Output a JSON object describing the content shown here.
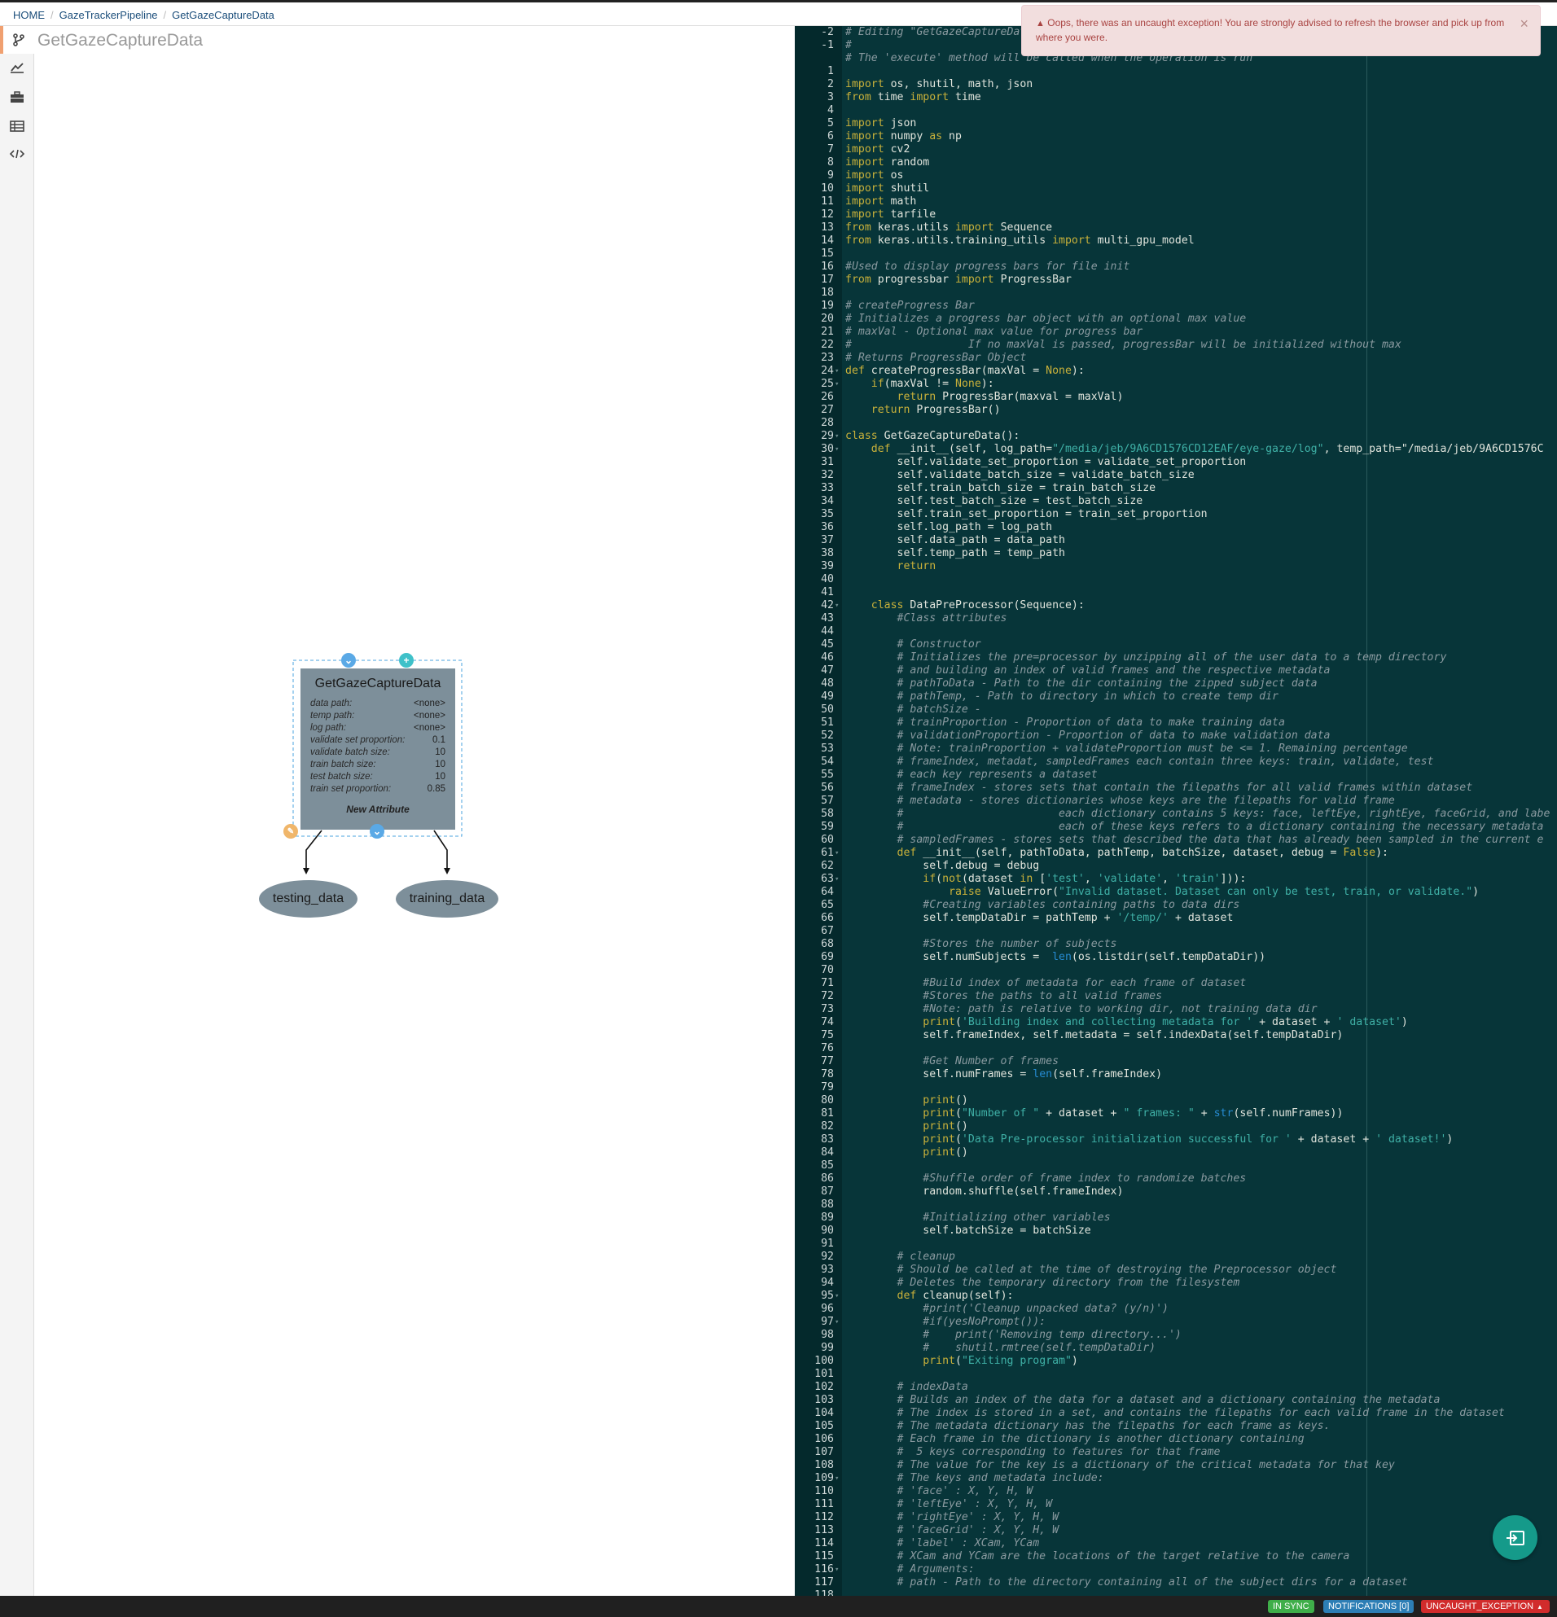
{
  "breadcrumb": {
    "home": "HOME",
    "project": "GazeTrackerPipeline",
    "current": "GetGazeCaptureData"
  },
  "canvas": {
    "title": "GetGazeCaptureData"
  },
  "node": {
    "title": "GetGazeCaptureData",
    "attributes": [
      {
        "key": "data path:",
        "value": "<none>"
      },
      {
        "key": "temp path:",
        "value": "<none>"
      },
      {
        "key": "log path:",
        "value": "<none>"
      },
      {
        "key": "validate set proportion:",
        "value": "0.1"
      },
      {
        "key": "validate batch size:",
        "value": "10"
      },
      {
        "key": "train batch size:",
        "value": "10"
      },
      {
        "key": "test batch size:",
        "value": "10"
      },
      {
        "key": "train set proportion:",
        "value": "0.85"
      }
    ],
    "new_attribute": "New Attribute"
  },
  "outputs": {
    "left": "testing_data",
    "right": "training_data"
  },
  "alert": {
    "message": "Oops, there was an uncaught exception! You are strongly advised to refresh the browser and pick up from where you were.",
    "close": "×"
  },
  "status": {
    "sync": "IN SYNC",
    "notifications": "NOTIFICATIONS [0]",
    "exception": "UNCAUGHT_EXCEPTION"
  },
  "colors": {
    "editor_bg": "#073539",
    "node_bg": "#7d8f9a",
    "alert_bg": "#f2dede",
    "fab": "#159a8a",
    "sync_badge": "#3fae49",
    "notif_badge": "#2d7eb5",
    "exception_badge": "#d12c2c"
  },
  "icons": {
    "leftbar": [
      "branch-icon",
      "chart-icon",
      "toolbox-icon",
      "table-icon",
      "code-icon"
    ],
    "fab": "exit-panel-icon"
  },
  "editor_lines": [
    {
      "n": "-2",
      "t": "# Editing \"GetGazeCaptureData\" Implementation",
      "c": "c"
    },
    {
      "n": "-1",
      "t": "#",
      "c": "c"
    },
    {
      "n": "",
      "t": "# The 'execute' method will be called when the operation is run",
      "c": "c"
    },
    {
      "n": "1",
      "t": "",
      "c": ""
    },
    {
      "n": "2",
      "t": "import os, shutil, math, json",
      "c": "imp"
    },
    {
      "n": "3",
      "t": "from time import time",
      "c": "imp"
    },
    {
      "n": "4",
      "t": "",
      "c": ""
    },
    {
      "n": "5",
      "t": "import json",
      "c": "imp"
    },
    {
      "n": "6",
      "t": "import numpy as np",
      "c": "imp"
    },
    {
      "n": "7",
      "t": "import cv2",
      "c": "imp"
    },
    {
      "n": "8",
      "t": "import random",
      "c": "imp"
    },
    {
      "n": "9",
      "t": "import os",
      "c": "imp"
    },
    {
      "n": "10",
      "t": "import shutil",
      "c": "imp"
    },
    {
      "n": "11",
      "t": "import math",
      "c": "imp"
    },
    {
      "n": "12",
      "t": "import tarfile",
      "c": "imp"
    },
    {
      "n": "13",
      "t": "from keras.utils import Sequence",
      "c": "imp"
    },
    {
      "n": "14",
      "t": "from keras.utils.training_utils import multi_gpu_model",
      "c": "imp"
    },
    {
      "n": "15",
      "t": "",
      "c": ""
    },
    {
      "n": "16",
      "t": "#Used to display progress bars for file init",
      "c": "c"
    },
    {
      "n": "17",
      "t": "from progressbar import ProgressBar",
      "c": "imp"
    },
    {
      "n": "18",
      "t": "",
      "c": ""
    },
    {
      "n": "19",
      "t": "# createProgress Bar",
      "c": "c"
    },
    {
      "n": "20",
      "t": "# Initializes a progress bar object with an optional max value",
      "c": "c"
    },
    {
      "n": "21",
      "t": "# maxVal - Optional max value for progress bar",
      "c": "c"
    },
    {
      "n": "22",
      "t": "#                  If no maxVal is passed, progressBar will be initialized without max",
      "c": "c"
    },
    {
      "n": "23",
      "t": "# Returns ProgressBar Object",
      "c": "c"
    },
    {
      "n": "24",
      "t": "def createProgressBar(maxVal = None):",
      "c": "",
      "f": true
    },
    {
      "n": "25",
      "t": "    if(maxVal != None):",
      "c": "",
      "f": true
    },
    {
      "n": "26",
      "t": "        return ProgressBar(maxval = maxVal)",
      "c": ""
    },
    {
      "n": "27",
      "t": "    return ProgressBar()",
      "c": ""
    },
    {
      "n": "28",
      "t": "",
      "c": ""
    },
    {
      "n": "29",
      "t": "class GetGazeCaptureData():",
      "c": "",
      "f": true
    },
    {
      "n": "30",
      "t": "    def __init__(self, log_path=\"/media/jeb/9A6CD1576CD12EAF/eye-gaze/log\", temp_path=\"/media/jeb/9A6CD1576C",
      "c": "",
      "f": true
    },
    {
      "n": "31",
      "t": "        self.validate_set_proportion = validate_set_proportion",
      "c": ""
    },
    {
      "n": "32",
      "t": "        self.validate_batch_size = validate_batch_size",
      "c": ""
    },
    {
      "n": "33",
      "t": "        self.train_batch_size = train_batch_size",
      "c": ""
    },
    {
      "n": "34",
      "t": "        self.test_batch_size = test_batch_size",
      "c": ""
    },
    {
      "n": "35",
      "t": "        self.train_set_proportion = train_set_proportion",
      "c": ""
    },
    {
      "n": "36",
      "t": "        self.log_path = log_path",
      "c": ""
    },
    {
      "n": "37",
      "t": "        self.data_path = data_path",
      "c": ""
    },
    {
      "n": "38",
      "t": "        self.temp_path = temp_path",
      "c": ""
    },
    {
      "n": "39",
      "t": "        return",
      "c": ""
    },
    {
      "n": "40",
      "t": "",
      "c": ""
    },
    {
      "n": "41",
      "t": "",
      "c": ""
    },
    {
      "n": "42",
      "t": "    class DataPreProcessor(Sequence):",
      "c": "",
      "f": true
    },
    {
      "n": "43",
      "t": "        #Class attributes",
      "c": "c"
    },
    {
      "n": "44",
      "t": "",
      "c": ""
    },
    {
      "n": "45",
      "t": "        # Constructor",
      "c": "c"
    },
    {
      "n": "46",
      "t": "        # Initializes the pre=processor by unzipping all of the user data to a temp directory",
      "c": "c"
    },
    {
      "n": "47",
      "t": "        # and building an index of valid frames and the respective metadata",
      "c": "c"
    },
    {
      "n": "48",
      "t": "        # pathToData - Path to the dir containing the zipped subject data",
      "c": "c"
    },
    {
      "n": "49",
      "t": "        # pathTemp, - Path to directory in which to create temp dir",
      "c": "c"
    },
    {
      "n": "50",
      "t": "        # batchSize -",
      "c": "c"
    },
    {
      "n": "51",
      "t": "        # trainProportion - Proportion of data to make training data",
      "c": "c"
    },
    {
      "n": "52",
      "t": "        # validationProportion - Proportion of data to make validation data",
      "c": "c"
    },
    {
      "n": "53",
      "t": "        # Note: trainProportion + validateProportion must be <= 1. Remaining percentage",
      "c": "c"
    },
    {
      "n": "54",
      "t": "        # frameIndex, metadat, sampledFrames each contain three keys: train, validate, test",
      "c": "c"
    },
    {
      "n": "55",
      "t": "        # each key represents a dataset",
      "c": "c"
    },
    {
      "n": "56",
      "t": "        # frameIndex - stores sets that contain the filepaths for all valid frames within dataset",
      "c": "c"
    },
    {
      "n": "57",
      "t": "        # metadata - stores dictionaries whose keys are the filepaths for valid frame",
      "c": "c"
    },
    {
      "n": "58",
      "t": "        #                        each dictionary contains 5 keys: face, leftEye, rightEye, faceGrid, and labe",
      "c": "c"
    },
    {
      "n": "59",
      "t": "        #                        each of these keys refers to a dictionary containing the necessary metadata",
      "c": "c"
    },
    {
      "n": "60",
      "t": "        # sampledFrames - stores sets that described the data that has already been sampled in the current e",
      "c": "c"
    },
    {
      "n": "61",
      "t": "        def __init__(self, pathToData, pathTemp, batchSize, dataset, debug = False):",
      "c": "",
      "f": true
    },
    {
      "n": "62",
      "t": "            self.debug = debug",
      "c": ""
    },
    {
      "n": "63",
      "t": "            if(not(dataset in ['test', 'validate', 'train'])):",
      "c": "",
      "f": true
    },
    {
      "n": "64",
      "t": "                raise ValueError(\"Invalid dataset. Dataset can only be test, train, or validate.\")",
      "c": ""
    },
    {
      "n": "65",
      "t": "            #Creating variables containing paths to data dirs",
      "c": "c"
    },
    {
      "n": "66",
      "t": "            self.tempDataDir = pathTemp + '/temp/' + dataset",
      "c": ""
    },
    {
      "n": "67",
      "t": "",
      "c": ""
    },
    {
      "n": "68",
      "t": "            #Stores the number of subjects",
      "c": "c"
    },
    {
      "n": "69",
      "t": "            self.numSubjects =  len(os.listdir(self.tempDataDir))",
      "c": ""
    },
    {
      "n": "70",
      "t": "",
      "c": ""
    },
    {
      "n": "71",
      "t": "            #Build index of metadata for each frame of dataset",
      "c": "c"
    },
    {
      "n": "72",
      "t": "            #Stores the paths to all valid frames",
      "c": "c"
    },
    {
      "n": "73",
      "t": "            #Note: path is relative to working dir, not training data dir",
      "c": "c"
    },
    {
      "n": "74",
      "t": "            print('Building index and collecting metadata for ' + dataset + ' dataset')",
      "c": ""
    },
    {
      "n": "75",
      "t": "            self.frameIndex, self.metadata = self.indexData(self.tempDataDir)",
      "c": ""
    },
    {
      "n": "76",
      "t": "",
      "c": ""
    },
    {
      "n": "77",
      "t": "            #Get Number of frames",
      "c": "c"
    },
    {
      "n": "78",
      "t": "            self.numFrames = len(self.frameIndex)",
      "c": ""
    },
    {
      "n": "79",
      "t": "",
      "c": ""
    },
    {
      "n": "80",
      "t": "            print()",
      "c": ""
    },
    {
      "n": "81",
      "t": "            print(\"Number of \" + dataset + \" frames: \" + str(self.numFrames))",
      "c": ""
    },
    {
      "n": "82",
      "t": "            print()",
      "c": ""
    },
    {
      "n": "83",
      "t": "            print('Data Pre-processor initialization successful for ' + dataset + ' dataset!')",
      "c": ""
    },
    {
      "n": "84",
      "t": "            print()",
      "c": ""
    },
    {
      "n": "85",
      "t": "",
      "c": ""
    },
    {
      "n": "86",
      "t": "            #Shuffle order of frame index to randomize batches",
      "c": "c"
    },
    {
      "n": "87",
      "t": "            random.shuffle(self.frameIndex)",
      "c": ""
    },
    {
      "n": "88",
      "t": "",
      "c": ""
    },
    {
      "n": "89",
      "t": "            #Initializing other variables",
      "c": "c"
    },
    {
      "n": "90",
      "t": "            self.batchSize = batchSize",
      "c": ""
    },
    {
      "n": "91",
      "t": "",
      "c": ""
    },
    {
      "n": "92",
      "t": "        # cleanup",
      "c": "c"
    },
    {
      "n": "93",
      "t": "        # Should be called at the time of destroying the Preprocessor object",
      "c": "c"
    },
    {
      "n": "94",
      "t": "        # Deletes the temporary directory from the filesystem",
      "c": "c"
    },
    {
      "n": "95",
      "t": "        def cleanup(self):",
      "c": "",
      "f": true
    },
    {
      "n": "96",
      "t": "            #print('Cleanup unpacked data? (y/n)')",
      "c": "c"
    },
    {
      "n": "97",
      "t": "            #if(yesNoPrompt()):",
      "c": "c",
      "f": true
    },
    {
      "n": "98",
      "t": "            #    print('Removing temp directory...')",
      "c": "c"
    },
    {
      "n": "99",
      "t": "            #    shutil.rmtree(self.tempDataDir)",
      "c": "c"
    },
    {
      "n": "100",
      "t": "            print(\"Exiting program\")",
      "c": ""
    },
    {
      "n": "101",
      "t": "",
      "c": ""
    },
    {
      "n": "102",
      "t": "        # indexData",
      "c": "c"
    },
    {
      "n": "103",
      "t": "        # Builds an index of the data for a dataset and a dictionary containing the metadata",
      "c": "c"
    },
    {
      "n": "104",
      "t": "        # The index is stored in a set, and contains the filepaths for each valid frame in the dataset",
      "c": "c"
    },
    {
      "n": "105",
      "t": "        # The metadata dictionary has the filepaths for each frame as keys.",
      "c": "c"
    },
    {
      "n": "106",
      "t": "        # Each frame in the dictionary is another dictionary containing",
      "c": "c"
    },
    {
      "n": "107",
      "t": "        #  5 keys corresponding to features for that frame",
      "c": "c"
    },
    {
      "n": "108",
      "t": "        # The value for the key is a dictionary of the critical metadata for that key",
      "c": "c"
    },
    {
      "n": "109",
      "t": "        # The keys and metadata include:",
      "c": "c",
      "f": true
    },
    {
      "n": "110",
      "t": "        # 'face' : X, Y, H, W",
      "c": "c"
    },
    {
      "n": "111",
      "t": "        # 'leftEye' : X, Y, H, W",
      "c": "c"
    },
    {
      "n": "112",
      "t": "        # 'rightEye' : X, Y, H, W",
      "c": "c"
    },
    {
      "n": "113",
      "t": "        # 'faceGrid' : X, Y, H, W",
      "c": "c"
    },
    {
      "n": "114",
      "t": "        # 'label' : XCam, YCam",
      "c": "c"
    },
    {
      "n": "115",
      "t": "        # XCam and YCam are the locations of the target relative to the camera",
      "c": "c"
    },
    {
      "n": "116",
      "t": "        # Arguments:",
      "c": "c",
      "f": true
    },
    {
      "n": "117",
      "t": "        # path - Path to the directory containing all of the subject dirs for a dataset",
      "c": "c"
    },
    {
      "n": "118",
      "t": "",
      "c": ""
    }
  ]
}
